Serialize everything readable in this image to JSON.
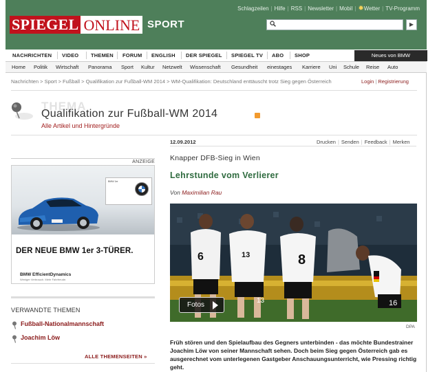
{
  "header": {
    "service_links": [
      "Schlagzeilen",
      "Hilfe",
      "RSS",
      "Newsletter",
      "Mobil",
      "Wetter",
      "TV-Programm"
    ],
    "logo_part1": "SPIEGEL",
    "logo_part2": "ONLINE",
    "section": "SPORT",
    "search_placeholder": ""
  },
  "main_nav": [
    "NACHRICHTEN",
    "VIDEO",
    "THEMEN",
    "FORUM",
    "ENGLISH",
    "DER SPIEGEL",
    "SPIEGEL TV",
    "ABO",
    "SHOP"
  ],
  "promo_button": "Neues von BMW",
  "sub_nav": [
    "Home",
    "Politik",
    "Wirtschaft",
    "Panorama",
    "Sport",
    "Kultur",
    "Netzwelt",
    "Wissenschaft",
    "Gesundheit",
    "einestages",
    "Karriere",
    "Uni",
    "Schule",
    "Reise",
    "Auto"
  ],
  "breadcrumb": "Nachrichten > Sport > Fußball > Qualifikation zur Fußball-WM 2014 > WM-Qualifikation: Deutschland enttäuscht trotz Sieg gegen Österreich",
  "account": {
    "login": "Login",
    "register": "Registrierung"
  },
  "thema": {
    "word": "THEMA",
    "title": "Qualifikation zur Fußball-WM 2014",
    "subtitle": "Alle Artikel und Hintergründe"
  },
  "ad": {
    "label": "ANZEIGE",
    "headline": "DER NEUE BMW 1er 3-TÜRER.",
    "brand_line": "BMW EfficientDynamics",
    "small_print": "Weniger Verbrauch. Mehr Fahrfreude."
  },
  "related": {
    "title": "VERWANDTE THEMEN",
    "items": [
      "Fußball-Nationalmannschaft",
      "Joachim Löw"
    ],
    "more": "ALLE THEMENSEITEN »"
  },
  "article": {
    "date": "12.09.2012",
    "tools": [
      "Drucken",
      "Senden",
      "Feedback",
      "Merken"
    ],
    "kicker": "Knapper DFB-Sieg in Wien",
    "headline": "Lehrstunde vom Verlierer",
    "by_prefix": "Von",
    "author": "Maximilian Rau",
    "photo_button": "Fotos",
    "photo_credit": "DPA",
    "lead": "Früh stören und den Spielaufbau des Gegners unterbinden - das möchte Bundestrainer Joachim Löw von seiner Mannschaft sehen. Doch beim Sieg gegen Österreich gab es ausgerechnet vom unterlegenen Gastgeber Anschauungsunterricht, wie Pressing richtig geht."
  },
  "colors": {
    "header_green": "#4e7f5a",
    "spiegel_red": "#c1121c",
    "headline_green": "#2f6b3f",
    "link_red": "#8a1a1a"
  }
}
